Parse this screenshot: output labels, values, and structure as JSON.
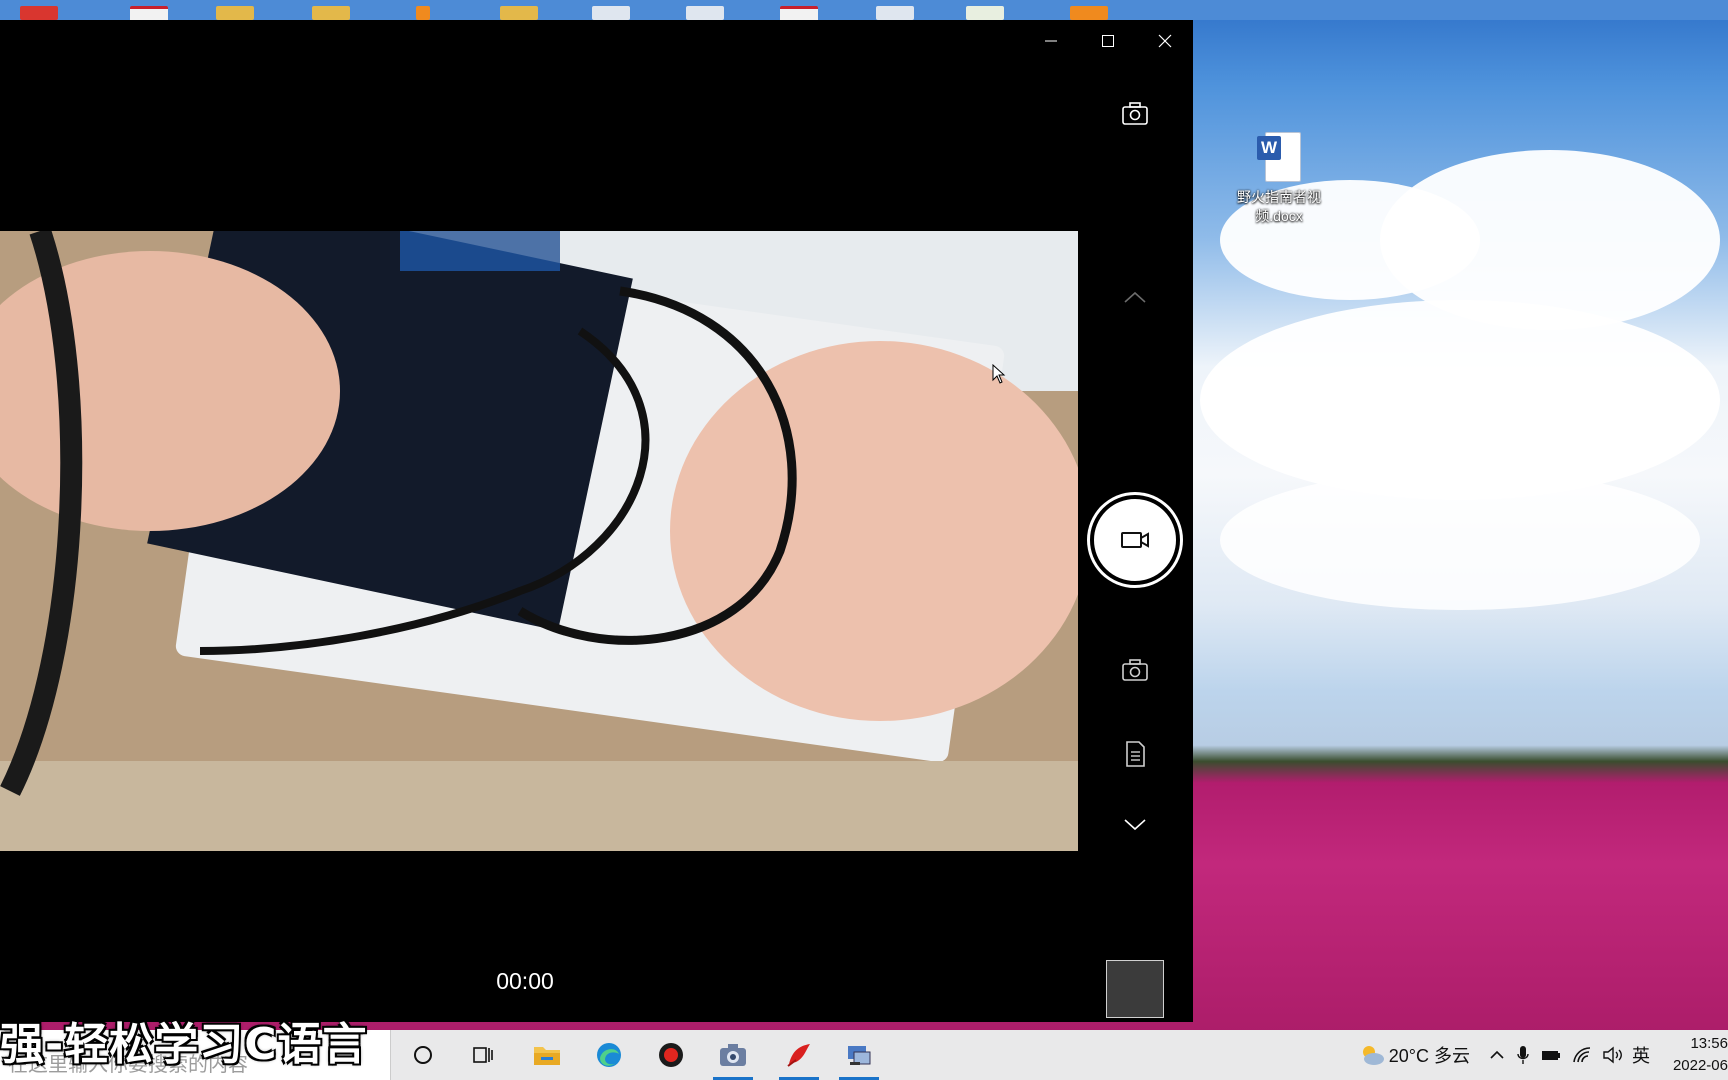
{
  "desktop": {
    "icon": {
      "label": "野火指南者视频.docx",
      "badge": "W"
    }
  },
  "camera_app": {
    "window_controls": {
      "minimize": "minimize-icon",
      "maximize": "maximize-icon",
      "close": "close-icon"
    },
    "rail": [
      "switch-camera-icon",
      "chevron-up-icon",
      "video-camera-icon",
      "photo-camera-icon",
      "document-scan-icon",
      "chevron-down-icon"
    ],
    "timer": "00:00",
    "preview_description_colors": {
      "accent": "#ffffff",
      "background": "#000000"
    }
  },
  "taskbar": {
    "search_placeholder": "在这里输入你要搜索的内容",
    "apps": [
      "cortana-icon",
      "task-view-icon",
      "file-explorer-icon",
      "edge-icon",
      "recorder-icon",
      "camera-icon",
      "app-red-icon",
      "network-app-icon"
    ],
    "tray": {
      "weather": "20°C 多云",
      "ime": "英",
      "time": "13:56",
      "date": "2022-06"
    }
  },
  "overlay": {
    "caption": "强-轻松学习C语言"
  }
}
